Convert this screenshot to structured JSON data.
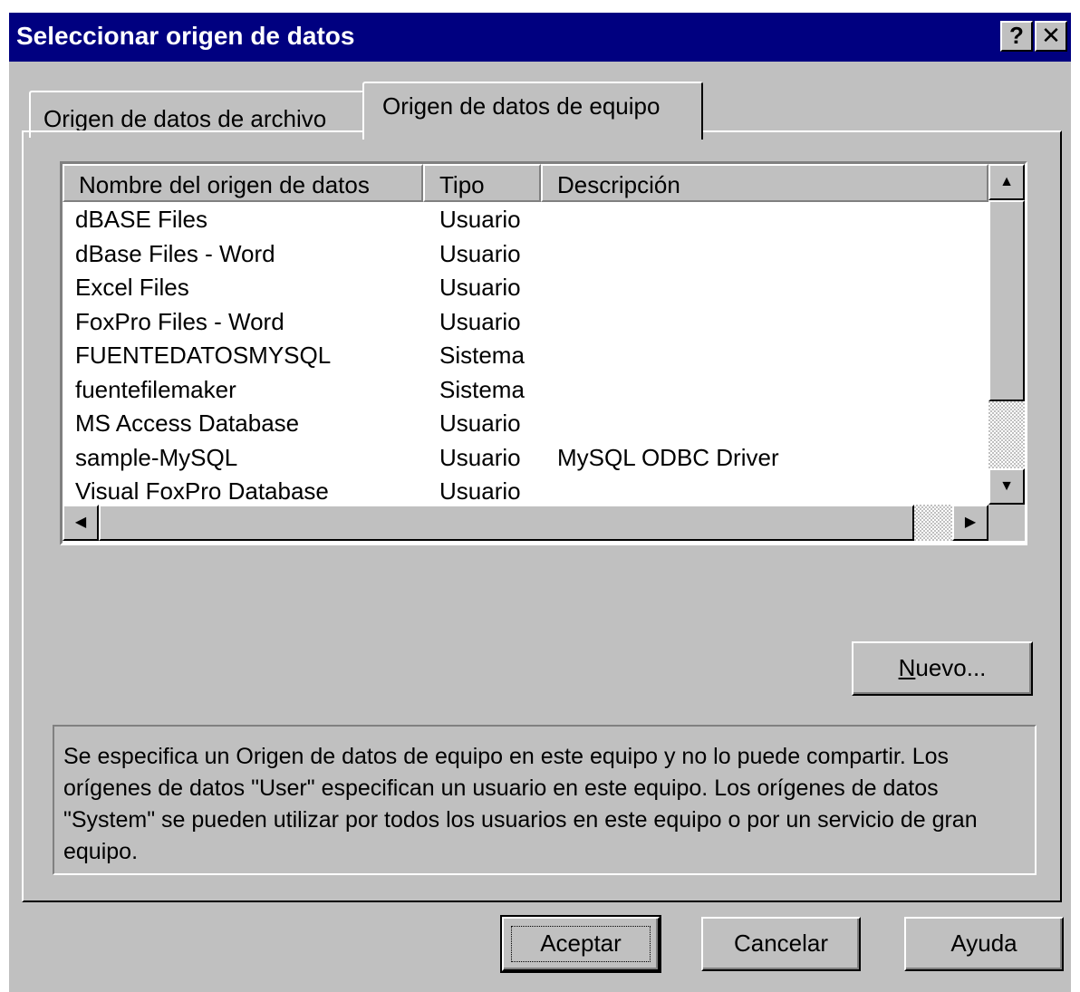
{
  "window": {
    "title": "Seleccionar origen de datos",
    "help_glyph": "?",
    "close_glyph": "✕"
  },
  "tabs": [
    {
      "label": "Origen de datos de archivo",
      "selected": false
    },
    {
      "label": "Origen de datos de equipo",
      "selected": true
    }
  ],
  "list": {
    "columns": [
      "Nombre del origen de datos",
      "Tipo",
      "Descripción"
    ],
    "rows": [
      {
        "name": "dBASE Files",
        "type": "Usuario",
        "desc": ""
      },
      {
        "name": "dBase Files - Word",
        "type": "Usuario",
        "desc": ""
      },
      {
        "name": "Excel Files",
        "type": "Usuario",
        "desc": ""
      },
      {
        "name": "FoxPro Files - Word",
        "type": "Usuario",
        "desc": ""
      },
      {
        "name": "FUENTEDATOSMYSQL",
        "type": "Sistema",
        "desc": ""
      },
      {
        "name": "fuentefilemaker",
        "type": "Sistema",
        "desc": ""
      },
      {
        "name": "MS Access Database",
        "type": "Usuario",
        "desc": ""
      },
      {
        "name": "sample-MySQL",
        "type": "Usuario",
        "desc": "MySQL ODBC Driver"
      },
      {
        "name": "Visual FoxPro Database",
        "type": "Usuario",
        "desc": ""
      }
    ],
    "scroll_up_glyph": "▲",
    "scroll_down_glyph": "▼",
    "scroll_left_glyph": "◀",
    "scroll_right_glyph": "▶"
  },
  "buttons": {
    "new_mnemonic": "N",
    "new_rest": "uevo...",
    "ok": "Aceptar",
    "cancel": "Cancelar",
    "help": "Ayuda"
  },
  "description": "Se especifica un Origen de datos de equipo en este equipo y no lo puede compartir. Los orígenes de datos \"User\" especifican un usuario en este equipo. Los orígenes de datos \"System\" se pueden utilizar por todos los usuarios en este equipo o por un servicio de gran equipo."
}
